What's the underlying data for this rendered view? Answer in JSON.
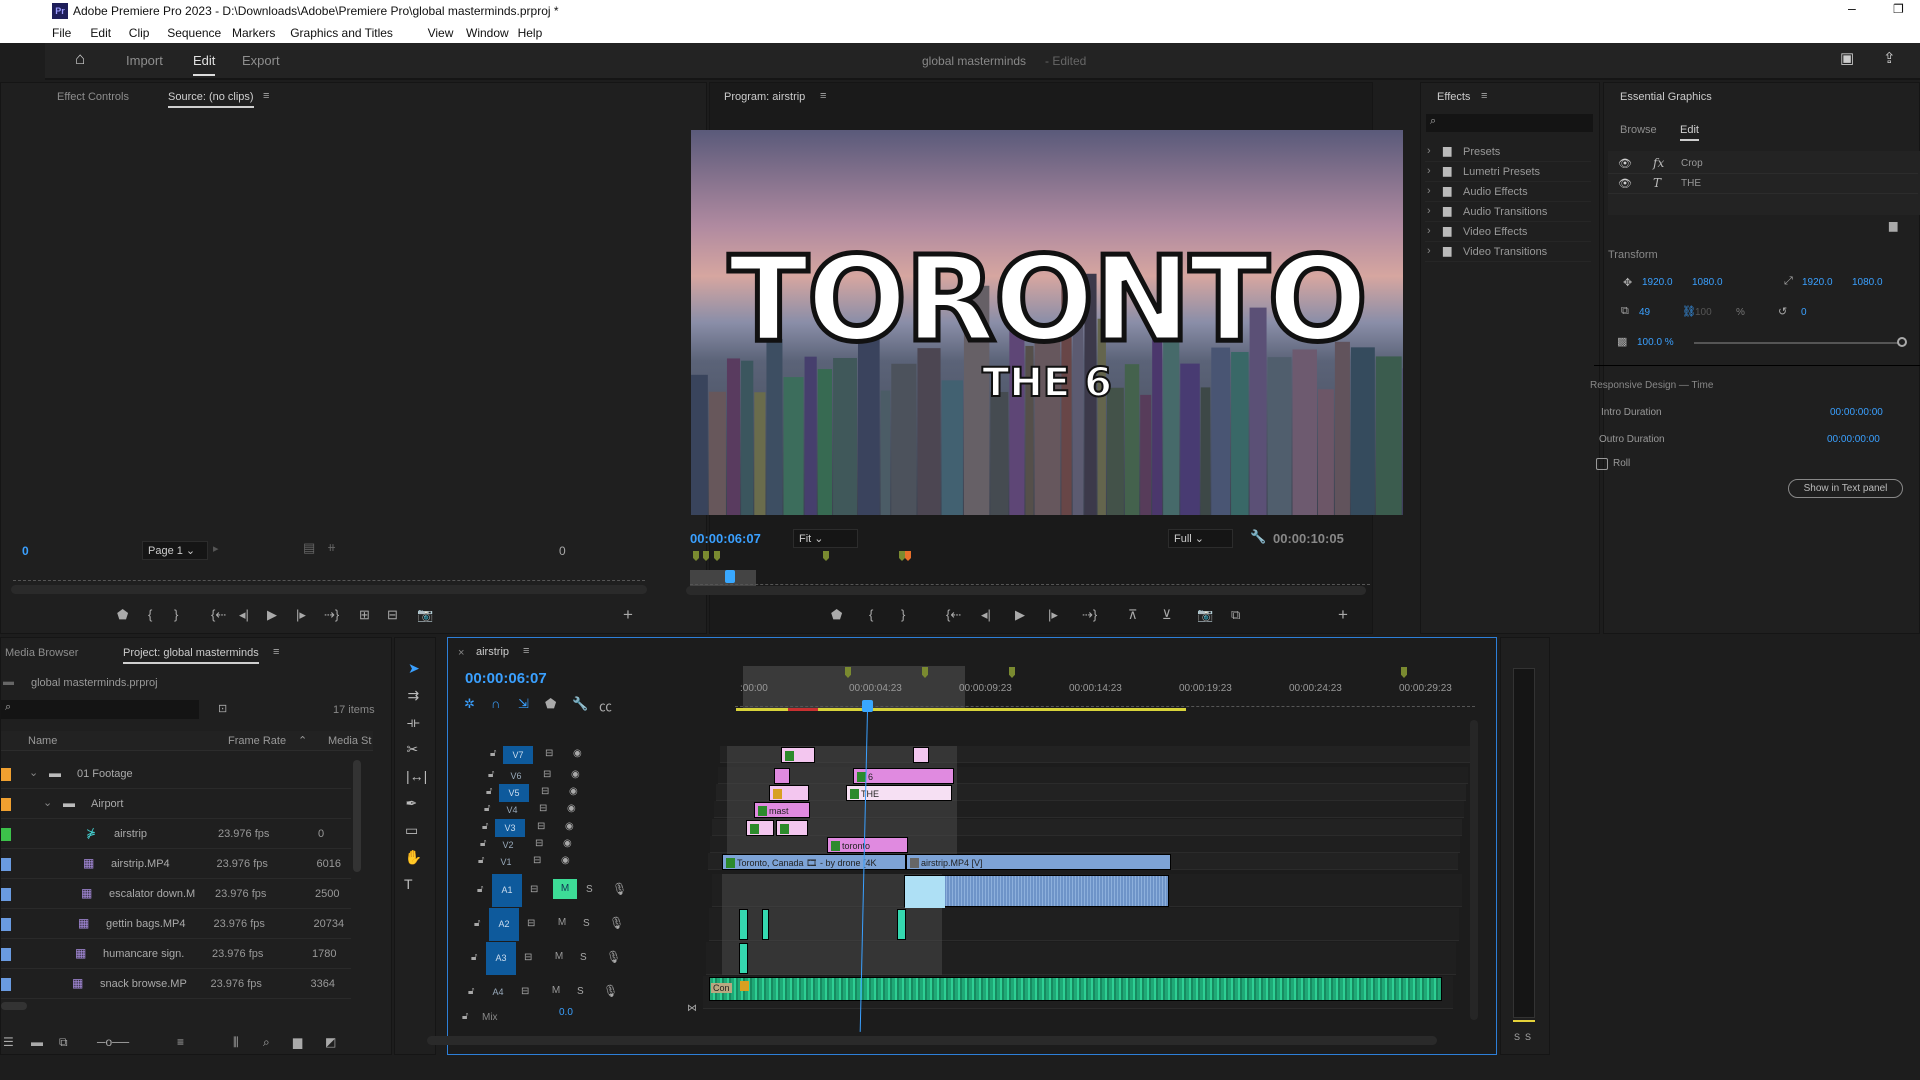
{
  "app": {
    "title": "Adobe Premiere Pro 2023 - D:\\Downloads\\Adobe\\Premiere Pro\\global masterminds.prproj *",
    "logo": "Pr",
    "menu": [
      "File",
      "Edit",
      "Clip",
      "Sequence",
      "Markers",
      "Graphics and Titles",
      "View",
      "Window",
      "Help"
    ]
  },
  "header": {
    "tabs": [
      "Import",
      "Edit",
      "Export"
    ],
    "active_tab": "Edit",
    "project_name": "global masterminds",
    "status": "- Edited",
    "icons": [
      "home-icon",
      "quick-export-icon",
      "share-icon"
    ]
  },
  "source": {
    "tabs": [
      "Effect Controls",
      "Source: (no clips)"
    ],
    "timecode_in": "0",
    "page": "Page 1",
    "timecode_out": "0"
  },
  "program": {
    "title": "Program: airstrip",
    "timecode": "00:00:06:07",
    "fit": "Fit",
    "quality": "Full",
    "duration": "00:00:10:05",
    "video_title": "TORONTO",
    "video_subtitle": "THE 6"
  },
  "effects": {
    "title": "Effects",
    "search_placeholder": "",
    "items": [
      "Presets",
      "Lumetri Presets",
      "Audio Effects",
      "Audio Transitions",
      "Video Effects",
      "Video Transitions"
    ]
  },
  "essential_graphics": {
    "title": "Essential Graphics",
    "tabs": [
      "Browse",
      "Edit"
    ],
    "active_tab": "Edit",
    "layers": [
      {
        "icon": "fx",
        "name": "Crop"
      },
      {
        "icon": "T",
        "name": "THE"
      }
    ],
    "transform_label": "Transform",
    "position": [
      "1920.0",
      "1080.0"
    ],
    "anchor": [
      "1920.0",
      "1080.0"
    ],
    "scale": "49",
    "scale_height": "100",
    "scale_unit": "%",
    "rotation": "0",
    "opacity": "100.0 %",
    "opacity_value": 100,
    "responsive_label": "Responsive Design — Time",
    "intro_label": "Intro Duration",
    "intro_value": "00:00:00:00",
    "outro_label": "Outro Duration",
    "outro_value": "00:00:00:00",
    "roll_label": "Roll",
    "roll_checked": false,
    "show_text_panel": "Show in Text panel"
  },
  "project": {
    "tabs": [
      "Media Browser",
      "Project: global masterminds"
    ],
    "file": "global masterminds.prproj",
    "item_count": "17 items",
    "columns": [
      "Name",
      "Frame Rate",
      "Media St"
    ],
    "rows": [
      {
        "name": "01 Footage",
        "type": "folder",
        "color": "#f0a030",
        "rate": "",
        "media": ""
      },
      {
        "name": "Airport",
        "type": "folder",
        "color": "#f0a030",
        "rate": "",
        "media": ""
      },
      {
        "name": "airstrip",
        "type": "sequence",
        "color": "#3cc24a",
        "rate": "23.976 fps",
        "media": "0"
      },
      {
        "name": "airstrip.MP4",
        "type": "clip",
        "color": "#6a9be0",
        "rate": "23.976 fps",
        "media": "6016"
      },
      {
        "name": "escalator down.M",
        "type": "clip",
        "color": "#6a9be0",
        "rate": "23.976 fps",
        "media": "2500"
      },
      {
        "name": "gettin bags.MP4",
        "type": "clip",
        "color": "#6a9be0",
        "rate": "23.976 fps",
        "media": "20734"
      },
      {
        "name": "humancare sign.",
        "type": "clip",
        "color": "#6a9be0",
        "rate": "23.976 fps",
        "media": "1780"
      },
      {
        "name": "snack browse.MP",
        "type": "clip",
        "color": "#6a9be0",
        "rate": "23.976 fps",
        "media": "3364"
      }
    ]
  },
  "timeline": {
    "sequence": "airstrip",
    "timecode": "00:00:06:07",
    "ruler": [
      ":00:00",
      "00:00:04:23",
      "00:00:09:23",
      "00:00:14:23",
      "00:00:19:23",
      "00:00:24:23",
      "00:00:29:23"
    ],
    "video_tracks": [
      "V7",
      "V6",
      "V5",
      "V4",
      "V3",
      "V2",
      "V1"
    ],
    "audio_tracks": [
      "A1",
      "A2",
      "A3",
      "A4"
    ],
    "mix_label": "Mix",
    "mix_value": "0.0",
    "clips": {
      "v6": "6",
      "v5": "THE",
      "v4": "mast",
      "v2": "toronto",
      "v1a": "Toronto, Canada 🎞 - by drone [4K",
      "v1b": "airstrip.MP4 [V]",
      "a4": "Con"
    },
    "track_buttons": {
      "mute": "M",
      "solo": "S"
    }
  },
  "meter": {
    "labels": [
      "S",
      "S"
    ]
  },
  "colors": {
    "accent": "#2d8ceb",
    "clip_pink": "#e08ae0",
    "clip_light": "#f3c6ef",
    "clip_blue": "#7da3d6",
    "audio_green": "#2ecf94"
  }
}
